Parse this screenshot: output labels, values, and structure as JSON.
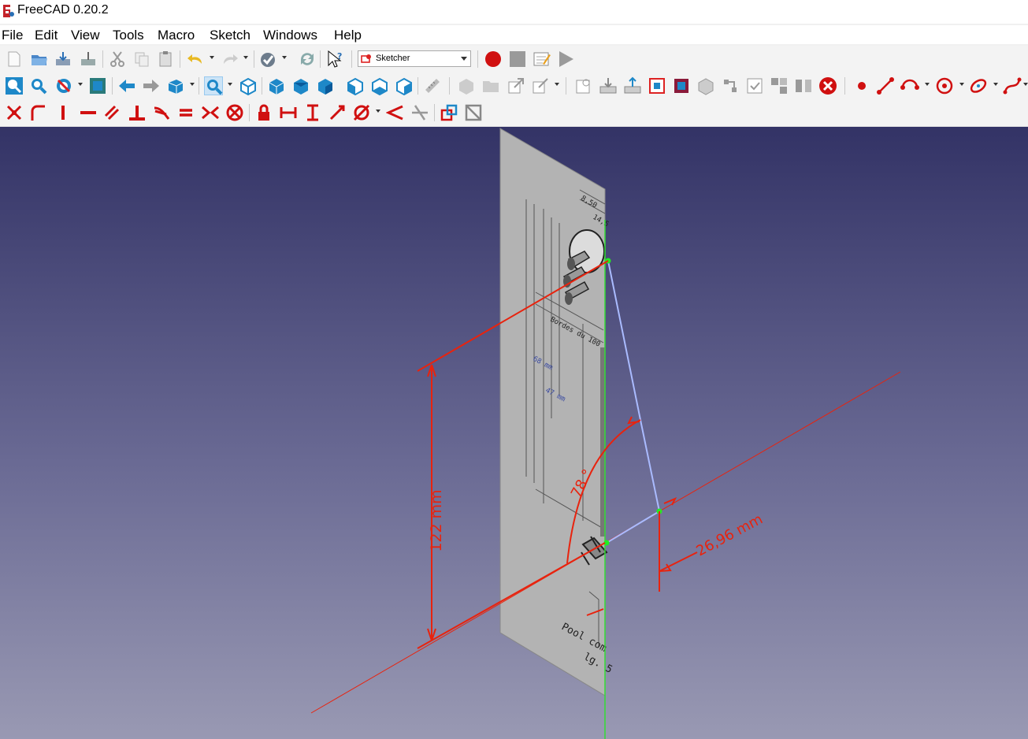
{
  "window": {
    "title": "FreeCAD 0.20.2"
  },
  "menubar": {
    "items": [
      {
        "label": "File"
      },
      {
        "label": "Edit"
      },
      {
        "label": "View"
      },
      {
        "label": "Tools"
      },
      {
        "label": "Macro"
      },
      {
        "label": "Sketch"
      },
      {
        "label": "Windows"
      },
      {
        "label": "Help"
      }
    ]
  },
  "toolbar": {
    "workbench": "Sketcher"
  },
  "viewport": {
    "dimensions": {
      "vertical": "122 mm",
      "angle": "78 °",
      "horizontal": "26,96 mm"
    },
    "drawing_text": {
      "line1": "Pool com",
      "line2": "lg. 5",
      "note1": "Bordes du 100",
      "note2": "68 mm",
      "note3": "47 mm",
      "top1": "8,50",
      "top2": "14,5"
    }
  },
  "colors": {
    "dimension": "#e8230e",
    "sketch_line": "#aabbff",
    "axis_green": "#33dd33",
    "vertex": "#22ee22",
    "accent_red": "#cc2222",
    "icon_blue": "#2a8fd0"
  }
}
